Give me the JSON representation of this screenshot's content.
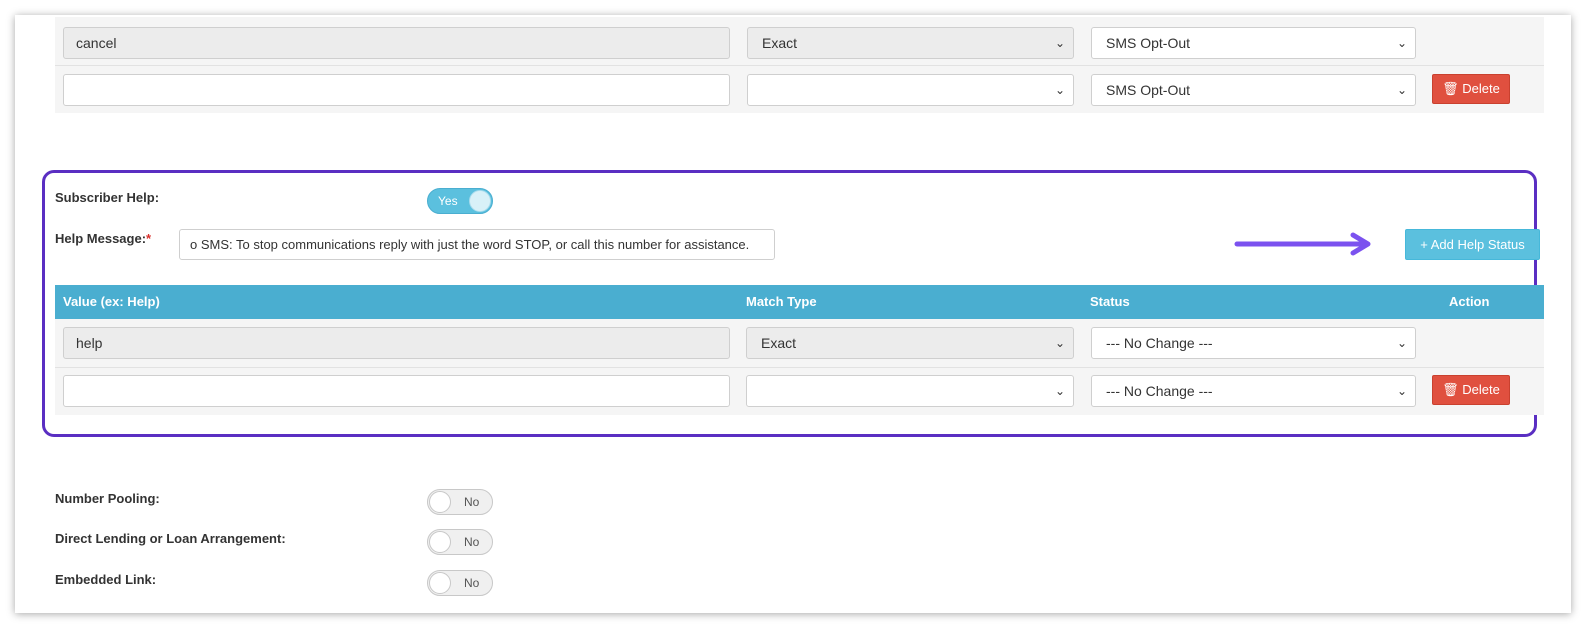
{
  "opt_out_rows": [
    {
      "value": "cancel",
      "match_type": "Exact",
      "status": "SMS Opt-Out"
    },
    {
      "value": "",
      "match_type": "",
      "status": "SMS Opt-Out",
      "delete_label": "Delete"
    }
  ],
  "subscriber_help": {
    "label": "Subscriber Help:",
    "toggle": "Yes"
  },
  "help_message": {
    "label": "Help Message:",
    "required_mark": "*",
    "value": "o SMS: To stop communications reply with just the word STOP, or call this number for assistance."
  },
  "add_help_status_label": "Add Help Status",
  "help_table": {
    "headers": [
      "Value (ex: Help)",
      "Match Type",
      "Status",
      "Action"
    ],
    "rows": [
      {
        "value": "help",
        "match_type": "Exact",
        "status": "--- No Change ---"
      },
      {
        "value": "",
        "match_type": "",
        "status": "--- No Change ---",
        "delete_label": "Delete"
      }
    ]
  },
  "settings": [
    {
      "label": "Number Pooling:",
      "toggle": "No"
    },
    {
      "label": "Direct Lending or Loan Arrangement:",
      "toggle": "No"
    },
    {
      "label": "Embedded Link:",
      "toggle": "No"
    }
  ],
  "colors": {
    "accent": "#4aaed0",
    "danger": "#e0503f",
    "highlight": "#5a2ec2"
  }
}
